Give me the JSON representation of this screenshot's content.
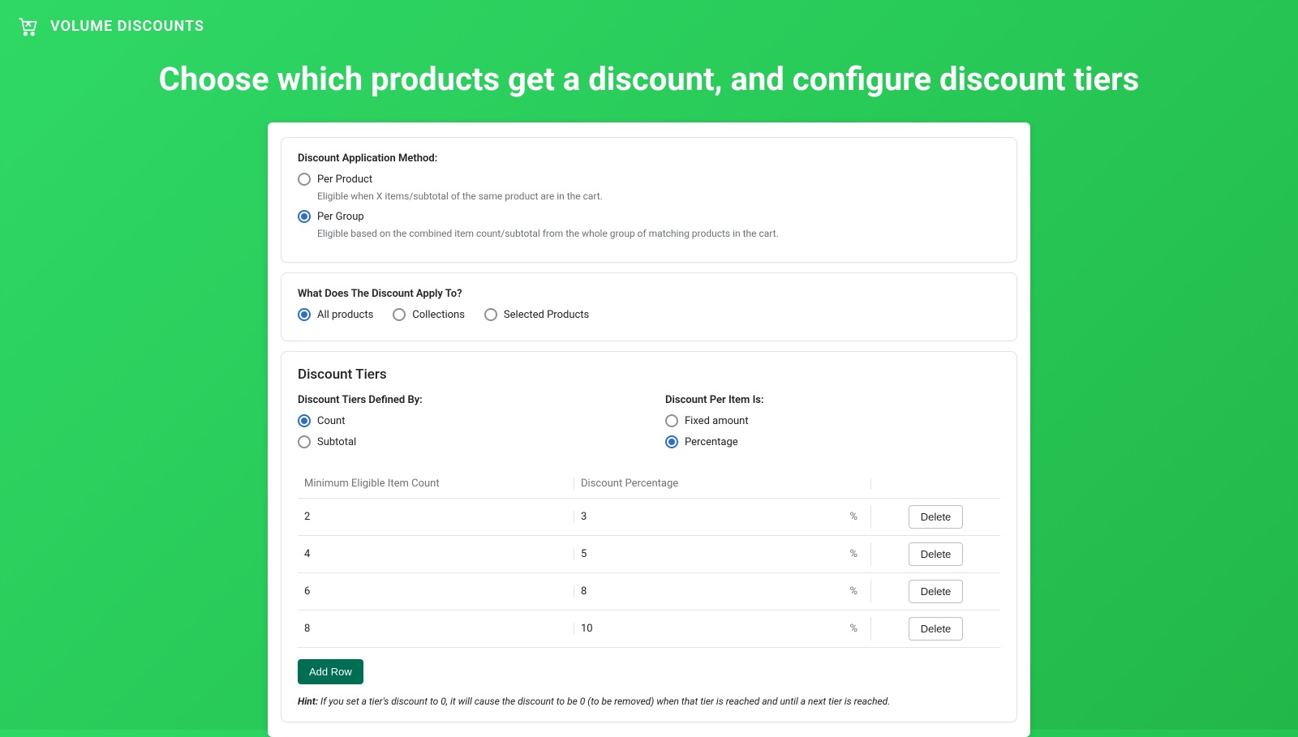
{
  "header": {
    "brand": "VOLUME DISCOUNTS"
  },
  "page": {
    "title": "Choose which products get a discount, and configure discount tiers"
  },
  "method": {
    "label": "Discount Application Method:",
    "options": [
      {
        "label": "Per Product",
        "desc": "Eligible when X items/subtotal of the same product are in the cart.",
        "checked": false
      },
      {
        "label": "Per Group",
        "desc": "Eligible based on the combined item count/subtotal from the whole group of matching products in the cart.",
        "checked": true
      }
    ]
  },
  "applyTo": {
    "label": "What Does The Discount Apply To?",
    "options": [
      {
        "label": "All products",
        "checked": true
      },
      {
        "label": "Collections",
        "checked": false
      },
      {
        "label": "Selected Products",
        "checked": false
      }
    ]
  },
  "tiers": {
    "title": "Discount Tiers",
    "definedBy": {
      "label": "Discount Tiers Defined By:",
      "options": [
        {
          "label": "Count",
          "checked": true
        },
        {
          "label": "Subtotal",
          "checked": false
        }
      ]
    },
    "perItem": {
      "label": "Discount Per Item Is:",
      "options": [
        {
          "label": "Fixed amount",
          "checked": false
        },
        {
          "label": "Percentage",
          "checked": true
        }
      ]
    },
    "table": {
      "headers": {
        "count": "Minimum Eligible Item Count",
        "discount": "Discount Percentage"
      },
      "unit": "%",
      "deleteLabel": "Delete",
      "rows": [
        {
          "count": "2",
          "discount": "3"
        },
        {
          "count": "4",
          "discount": "5"
        },
        {
          "count": "6",
          "discount": "8"
        },
        {
          "count": "8",
          "discount": "10"
        }
      ]
    },
    "addRow": "Add Row",
    "hintLabel": "Hint:",
    "hintText": " If you set a tier's discount to 0, it will cause the discount to be 0 (to be removed) when that tier is reached and until a next tier is reached."
  }
}
